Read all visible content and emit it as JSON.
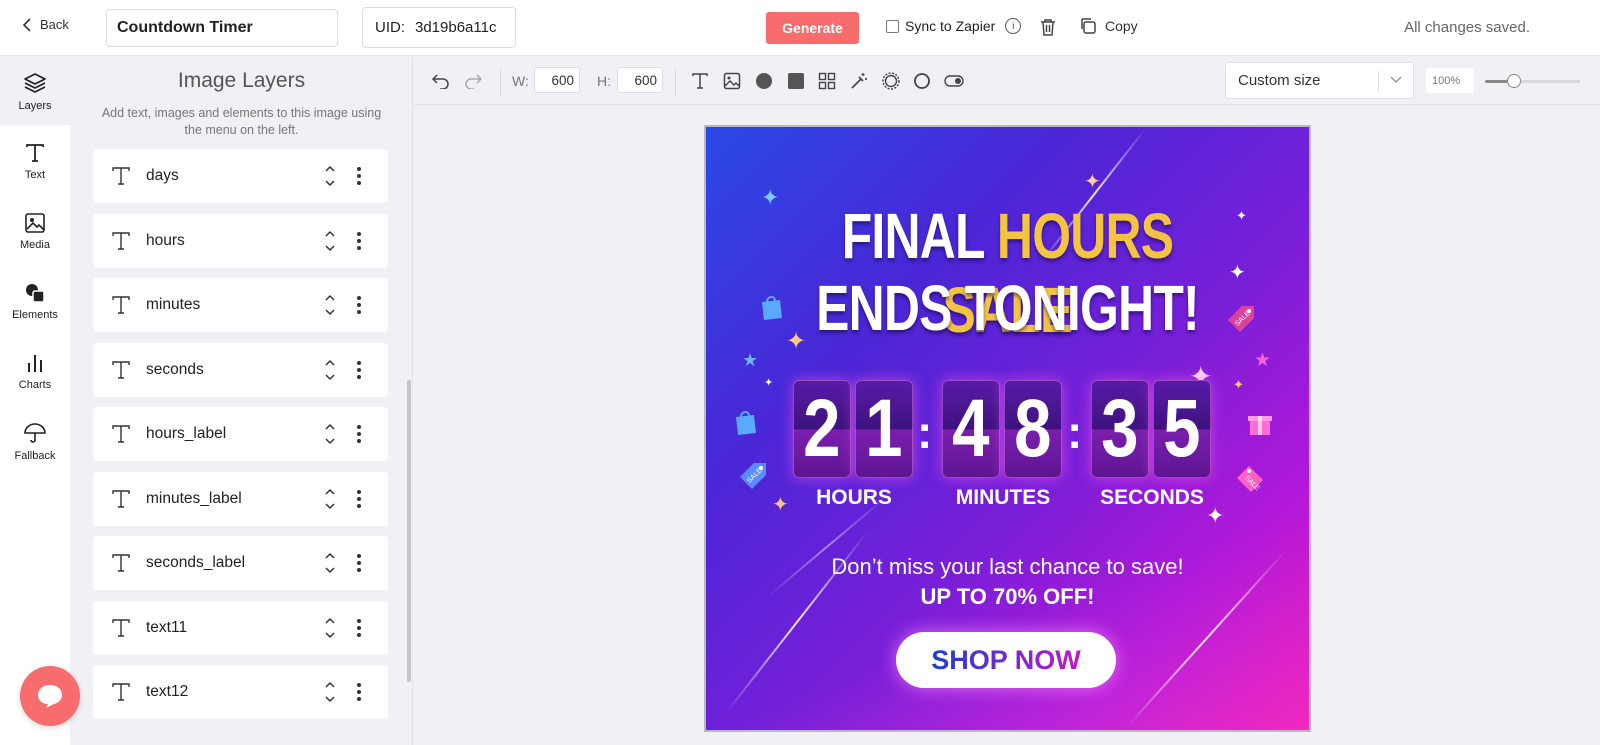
{
  "header": {
    "back_label": "Back",
    "title_value": "Countdown Timer",
    "uid_label": "UID:",
    "uid_value": "3d19b6a11c",
    "generate_label": "Generate",
    "sync_label": "Sync to Zapier",
    "copy_label": "Copy",
    "status": "All changes saved."
  },
  "rail": {
    "items": [
      {
        "label": "Layers",
        "icon": "layers-icon"
      },
      {
        "label": "Text",
        "icon": "text-icon"
      },
      {
        "label": "Media",
        "icon": "image-icon"
      },
      {
        "label": "Elements",
        "icon": "shapes-icon"
      },
      {
        "label": "Charts",
        "icon": "bar-chart-icon"
      },
      {
        "label": "Fallback",
        "icon": "umbrella-icon"
      }
    ]
  },
  "panel": {
    "title": "Image Layers",
    "subtitle": "Add text, images and elements to this image using the menu on the left.",
    "layers": [
      {
        "name": "days"
      },
      {
        "name": "hours"
      },
      {
        "name": "minutes"
      },
      {
        "name": "seconds"
      },
      {
        "name": "hours_label"
      },
      {
        "name": "minutes_label"
      },
      {
        "name": "seconds_label"
      },
      {
        "name": "text11"
      },
      {
        "name": "text12"
      }
    ]
  },
  "toolbar": {
    "width_label": "W:",
    "width_value": "600",
    "height_label": "H:",
    "height_value": "600",
    "size_preset": "Custom size",
    "zoom_label": "100%",
    "zoom_level": 0.3
  },
  "canvas": {
    "headline_line1_a": "FINAL ",
    "headline_line1_b": "HOURS SALE",
    "headline_line2": "ENDS TONIGHT!",
    "hours_d1": "2",
    "hours_d2": "1",
    "minutes_d1": "4",
    "minutes_d2": "8",
    "seconds_d1": "3",
    "seconds_d2": "5",
    "colon": ":",
    "hours_label": "HOURS",
    "minutes_label": "MINUTES",
    "seconds_label": "SECONDS",
    "tagline": "Don’t miss your last chance to save!",
    "offer": "UP TO 70% OFF!",
    "cta": "SHOP NOW",
    "sale_tag": "SALE"
  },
  "colors": {
    "accent": "#f76c6c",
    "gold": "#f3c441",
    "canvas_start": "#2a49e6",
    "canvas_end": "#ec12b4"
  }
}
